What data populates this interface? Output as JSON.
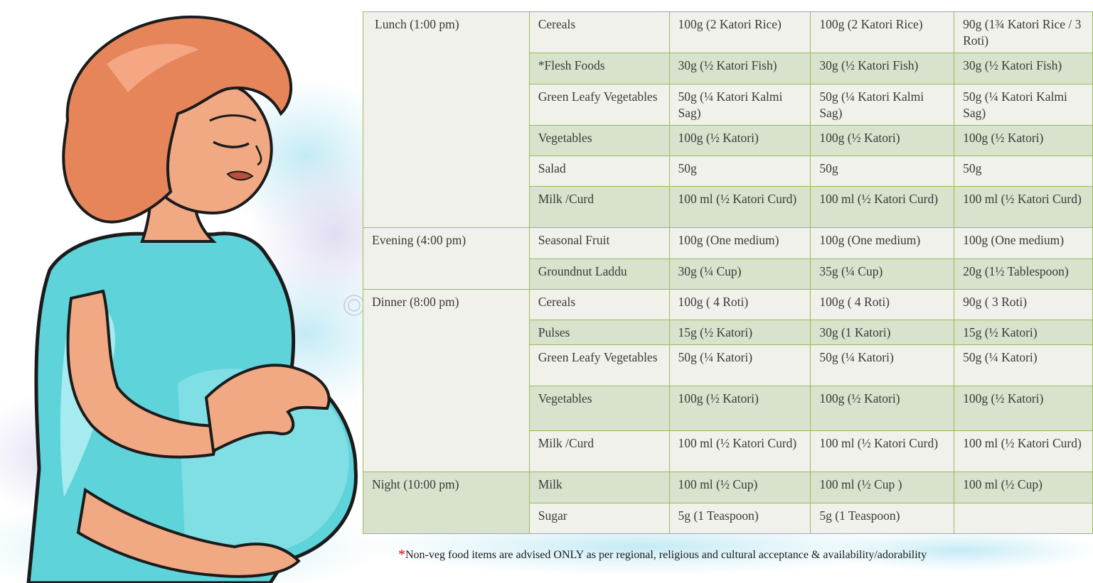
{
  "rows": [
    {
      "meal": "Lunch (1:00 pm)",
      "item": "Cereals",
      "c1": "100g (2 Katori Rice)",
      "c2": "100g (2 Katori Rice)",
      "c3": "90g (1¾ Katori Rice / 3 Roti)"
    },
    {
      "item": "*Flesh Foods",
      "c1": "30g (½ Katori Fish)",
      "c2": "30g (½ Katori Fish)",
      "c3": "30g (½ Katori Fish)"
    },
    {
      "item": "Green Leafy Vegetables",
      "c1": "50g (¼ Katori Kalmi Sag)",
      "c2": "50g (¼ Katori Kalmi Sag)",
      "c3": "50g (¼ Katori Kalmi Sag)"
    },
    {
      "item": "Vegetables",
      "c1": "100g (½ Katori)",
      "c2": "100g (½ Katori)",
      "c3": "100g (½ Katori)"
    },
    {
      "item": "Salad",
      "c1": "50g",
      "c2": "50g",
      "c3": "50g"
    },
    {
      "item": "Milk /Curd",
      "c1": "100 ml (½ Katori Curd)",
      "c2": "100 ml (½ Katori Curd)",
      "c3": "100 ml (½ Katori Curd)"
    },
    {
      "meal": "Evening (4:00 pm)",
      "item": "Seasonal Fruit",
      "c1": "100g (One medium)",
      "c2": "100g (One medium)",
      "c3": "100g (One medium)"
    },
    {
      "item": "Groundnut Laddu",
      "c1": "30g (¼ Cup)",
      "c2": "35g (¼ Cup)",
      "c3": "20g (1½ Tablespoon)"
    },
    {
      "meal": "Dinner (8:00 pm)",
      "item": "Cereals",
      "c1": "100g ( 4 Roti)",
      "c2": "100g ( 4 Roti)",
      "c3": "90g ( 3 Roti)"
    },
    {
      "item": "Pulses",
      "c1": "15g (½ Katori)",
      "c2": "30g (1 Katori)",
      "c3": "15g (½ Katori)"
    },
    {
      "item": "Green Leafy Vegetables",
      "c1": "50g (¼ Katori)",
      "c2": "50g (¼ Katori)",
      "c3": "50g (¼ Katori)"
    },
    {
      "item": "Vegetables",
      "c1": "100g (½ Katori)",
      "c2": "100g (½ Katori)",
      "c3": "100g (½ Katori)"
    },
    {
      "item": "Milk /Curd",
      "c1": "100 ml (½ Katori Curd)",
      "c2": "100 ml (½ Katori Curd)",
      "c3": "100 ml (½ Katori Curd)"
    },
    {
      "meal": "Night (10:00 pm)",
      "item": "Milk",
      "c1": "100 ml (½ Cup)",
      "c2": "100 ml (½ Cup )",
      "c3": "100 ml (½ Cup)"
    },
    {
      "item": "Sugar",
      "c1": "5g (1 Teaspoon)",
      "c2": "5g (1 Teaspoon)",
      "c3": ""
    }
  ],
  "footnote": {
    "star": "*",
    "text": "Non-veg food items are advised ONLY as per regional, religious and cultural acceptance & availability/adorability"
  },
  "colors": {
    "border": "#9bbb59",
    "row_light": "#eff1ea",
    "row_dark": "#d8e2cc",
    "dress": "#5ed3d9",
    "hair": "#e6845a",
    "skin": "#f1a984",
    "footnote_star": "#e00000"
  }
}
